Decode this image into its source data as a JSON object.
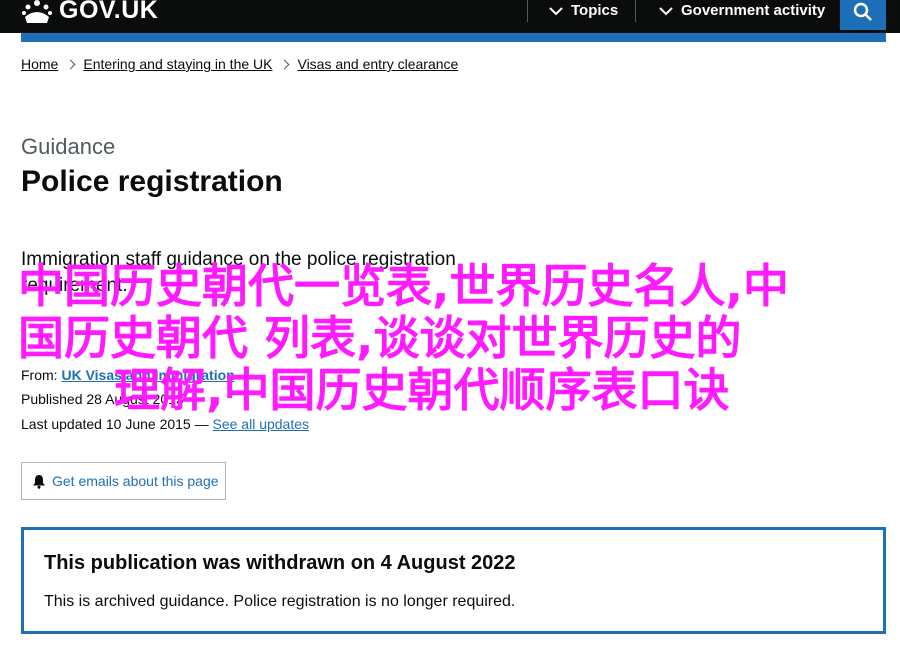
{
  "header": {
    "logo_text": "GOV.UK",
    "nav": [
      {
        "label": "Topics"
      },
      {
        "label": "Government activity"
      }
    ]
  },
  "breadcrumb": [
    "Home",
    "Entering and staying in the UK",
    "Visas and entry clearance"
  ],
  "page": {
    "caption": "Guidance",
    "title": "Police registration",
    "lead": "Immigration staff guidance on the police registration requirement."
  },
  "metadata": {
    "from_label": "From:",
    "from_value": "UK Visas and Immigration",
    "published_label": "Published",
    "published_value": "28 August 2013",
    "updated_label": "Last updated",
    "updated_value": "10 June 2015",
    "updated_sep": "—",
    "see_all": "See all updates"
  },
  "email_button": "Get emails about this page",
  "notice": {
    "title": "This publication was withdrawn on 4 August 2022",
    "body": "This is archived guidance. Police registration is no longer required."
  },
  "overlay": {
    "line1": "中国历史朝代一览表,世界历史名人,中",
    "line2": "国历史朝代 列表,谈谈对世界历史的",
    "line3": "理解,中国历史朝代顺序表口诀"
  },
  "colors": {
    "header_bg": "#0b0c0c",
    "brand_blue": "#1d70b8",
    "overlay_magenta": "#ff1aff"
  }
}
